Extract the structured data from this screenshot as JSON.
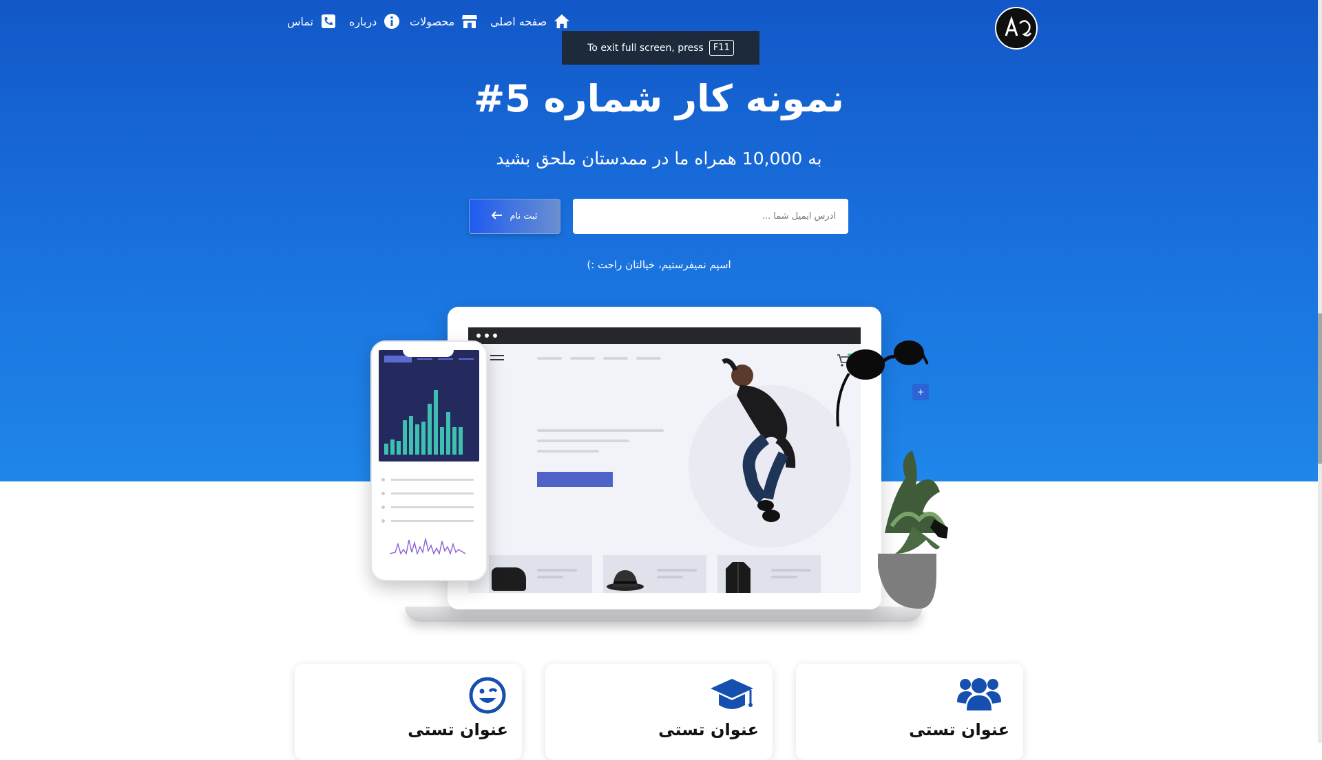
{
  "nav": {
    "items": [
      {
        "label": "صفحه اصلی",
        "icon": "home-icon"
      },
      {
        "label": "محصولات",
        "icon": "store-icon"
      },
      {
        "label": "درباره",
        "icon": "info-icon"
      },
      {
        "label": "تماس",
        "icon": "phone-icon"
      }
    ]
  },
  "fullscreen_toast": {
    "text": "To exit full screen, press",
    "key": "F11"
  },
  "hero": {
    "title": "نمونه کار شماره 5#",
    "subtitle": "به 10,000 همراه ما در ممدستان ملحق بشید",
    "email_placeholder": "آدرس ایمیل شما ...",
    "signup_label": "ثبت نام",
    "spam_note": "اسپم نمیفرستیم، خیالتان راحت :)"
  },
  "cards": [
    {
      "title": "عنوان تستی",
      "icon": "users-icon"
    },
    {
      "title": "عنوان تستی",
      "icon": "graduation-cap-icon"
    },
    {
      "title": "عنوان تستی",
      "icon": "wink-face-icon"
    }
  ],
  "colors": {
    "hero_top": "#1257c8",
    "hero_bottom": "#1f86ea",
    "icon_blue": "#1550b0",
    "chart_bar": "#3ec0b0",
    "phone_screen": "#252a5e"
  }
}
